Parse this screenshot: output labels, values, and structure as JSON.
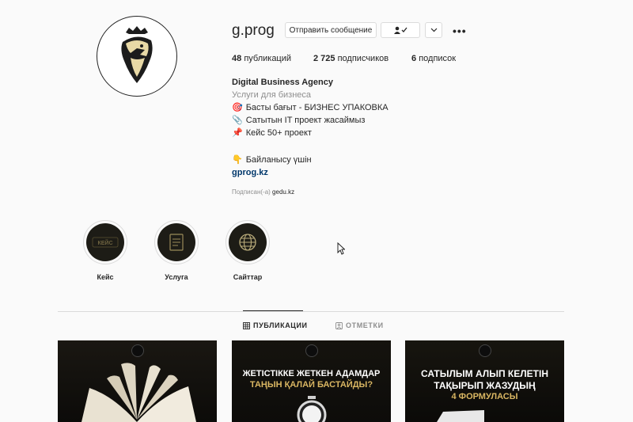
{
  "profile": {
    "username": "g.prog",
    "message_button": "Отправить сообщение",
    "follow_icon": "person-check-icon",
    "more_icon": "more-horizontal-icon"
  },
  "stats": {
    "posts_count": "48",
    "posts_label": "публикаций",
    "followers_count": "2 725",
    "followers_label": "подписчиков",
    "following_count": "6",
    "following_label": "подписок"
  },
  "bio": {
    "title": "Digital Business Agency",
    "category": "Услуги для бизнеса",
    "lines": [
      {
        "emoji": "🎯",
        "text": "Басты бағыт - БИЗНЕС УПАКОВКА"
      },
      {
        "emoji": "📎",
        "text": "Сатытын IT проект жасаймыз"
      },
      {
        "emoji": "📌",
        "text": "Кейс 50+ проект"
      }
    ],
    "contact": {
      "emoji": "👇",
      "text": "Байланысу үшін"
    },
    "link": "gprog.kz",
    "followed_by_prefix": "Подписан(-а)",
    "followed_by_name": "gedu.kz"
  },
  "highlights": [
    {
      "label": "Кейс",
      "icon": "keys-text-icon",
      "inner_text": "КЕЙС"
    },
    {
      "label": "Услуга",
      "icon": "document-icon",
      "inner_text": ""
    },
    {
      "label": "Сайттар",
      "icon": "globe-icon",
      "inner_text": ""
    }
  ],
  "tabs": [
    {
      "label": "ПУБЛИКАЦИИ",
      "icon": "grid-icon",
      "active": true
    },
    {
      "label": "ОТМЕТКИ",
      "icon": "tag-person-icon",
      "active": false
    }
  ],
  "posts": [
    {
      "line1": "",
      "line2": "",
      "image": "open-book"
    },
    {
      "line1": "ЖЕТІСТІККЕ ЖЕТКЕН АДАМДАР",
      "line2": "ТАҢЫН ҚАЛАЙ БАСТАЙДЫ?",
      "image": "alarm-clock"
    },
    {
      "line1": "САТЫЛЫМ АЛЫП КЕЛЕТІН",
      "line2": "ТАҚЫРЫП ЖАЗУДЫҢ",
      "line3": "4 ФОРМУЛАСЫ",
      "image": "paper"
    }
  ],
  "colors": {
    "accent_gold": "#d9b662",
    "link": "#00376b",
    "muted": "#8e8e8e"
  }
}
